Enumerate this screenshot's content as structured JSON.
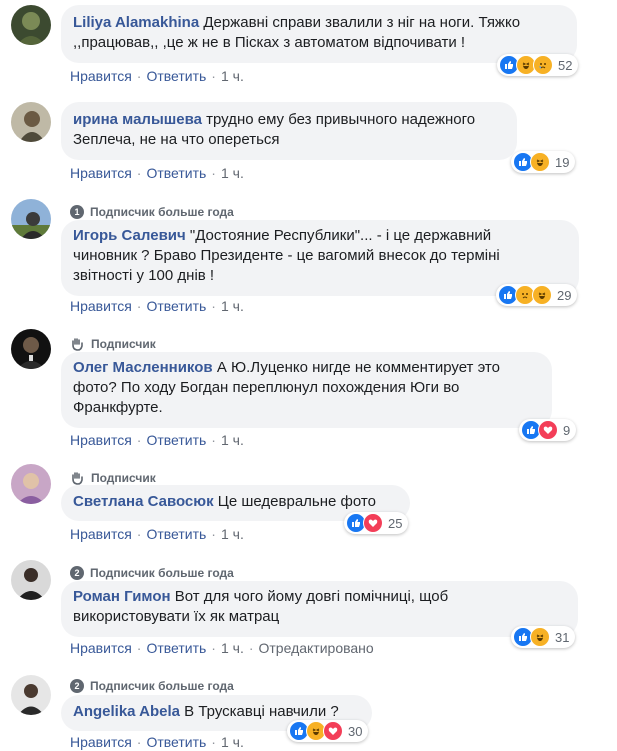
{
  "action_labels": {
    "like": "Нравится",
    "reply": "Ответить",
    "edited": "Отредактировано"
  },
  "comments": [
    {
      "badge": "",
      "author": "Liliya Alamakhina",
      "text_lines": [
        "Державні справи звалили з ніг на ноги. Тяжко",
        ",,працював,, ,це ж не в Пісках з автоматом відпочивати !"
      ],
      "time": "1 ч.",
      "reactions": [
        "like",
        "haha",
        "sad"
      ],
      "reaction_count": "52"
    },
    {
      "badge": "",
      "author": "ирина малышева",
      "text_lines": [
        "трудно ему без привычного надежного",
        "Зеплеча, не на что опереться"
      ],
      "time": "1 ч.",
      "reactions": [
        "like",
        "haha"
      ],
      "reaction_count": "19"
    },
    {
      "badge": "Подписчик больше года",
      "badge_icon": "1",
      "author": "Игорь Салевич",
      "text_lines": [
        "\"Достояние Республики\"... - і це державний",
        "чиновник ? Браво Президенте - це вагомий внесок до терміні",
        "звітності у 100 днів !"
      ],
      "time": "1 ч.",
      "reactions": [
        "like",
        "sad",
        "haha"
      ],
      "reaction_count": "29"
    },
    {
      "badge": "Подписчик",
      "author": "Олег Масленников",
      "text_lines": [
        "А Ю.Луценко нигде не комментирует это",
        "фото? По ходу Богдан переплюнул похождения Юги во",
        "Франкфурте."
      ],
      "time": "1 ч.",
      "reactions": [
        "like",
        "love"
      ],
      "reaction_count": "9"
    },
    {
      "badge": "Подписчик",
      "author": "Светлана Савосюк",
      "text_lines": [
        "Це шедевральне фото"
      ],
      "time": "1 ч.",
      "reactions": [
        "like",
        "love"
      ],
      "reaction_count": "25"
    },
    {
      "badge": "Подписчик больше года",
      "badge_icon": "2",
      "author": "Роман Гимон",
      "text_lines": [
        "Вот для чого йому довгі помічниці, щоб",
        "використовувати їх як матрац"
      ],
      "time": "1 ч.",
      "edited": true,
      "reactions": [
        "like",
        "haha"
      ],
      "reaction_count": "31"
    },
    {
      "badge": "Подписчик больше года",
      "badge_icon": "2",
      "author": "Angelika Abela",
      "text_lines": [
        "В Трускавці навчили ?"
      ],
      "time": "1 ч.",
      "reactions": [
        "like",
        "haha",
        "love"
      ],
      "reaction_count": "30"
    }
  ]
}
